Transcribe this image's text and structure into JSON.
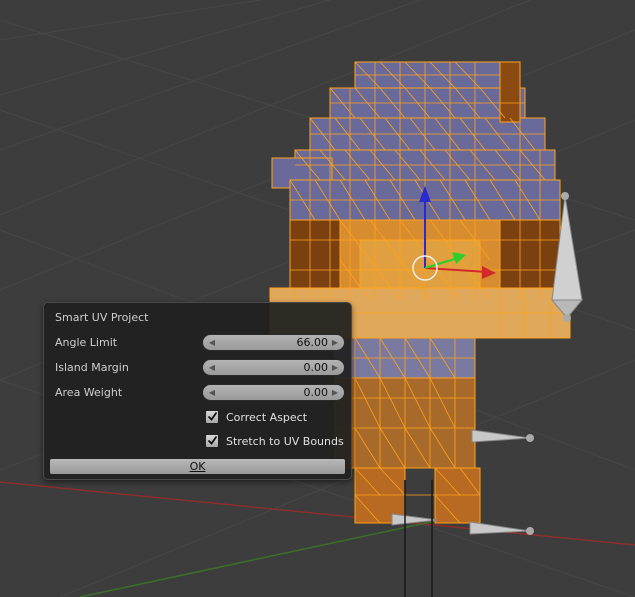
{
  "panel": {
    "title": "Smart UV Project",
    "fields": [
      {
        "label": "Angle Limit",
        "value": "66.00"
      },
      {
        "label": "Island Margin",
        "value": "0.00"
      },
      {
        "label": "Area Weight",
        "value": "0.00"
      }
    ],
    "checkboxes": [
      {
        "label": "Correct Aspect",
        "checked": true
      },
      {
        "label": "Stretch to UV Bounds",
        "checked": true
      }
    ],
    "ok_label": "OK"
  },
  "colors": {
    "background": "#3d3d3d",
    "grid": "#474747",
    "face_top": "#6a6a9a",
    "face_front": "#b86a22",
    "face_side": "#7a4010",
    "skin": "#e0a040",
    "edge": "#ffa21a",
    "axis_x": "#a03030",
    "axis_y": "#4a8a2a"
  },
  "icons": [
    "checkmark-icon",
    "arrow-left-icon",
    "arrow-right-icon"
  ]
}
